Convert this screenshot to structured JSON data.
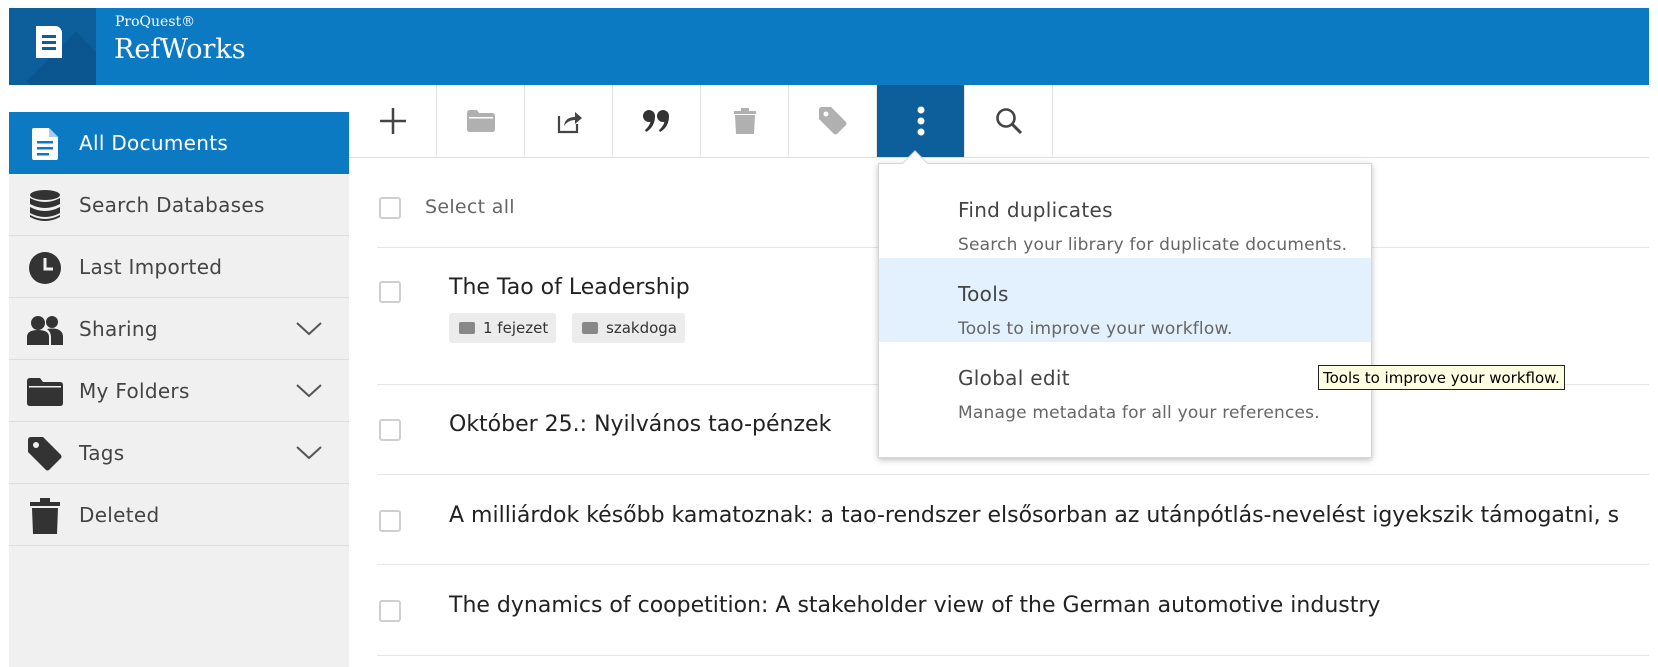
{
  "header": {
    "brand_small": "ProQuest®",
    "brand_large": "RefWorks",
    "color": "#0c79c3"
  },
  "sidebar": {
    "items": [
      {
        "label": "All Documents",
        "icon": "document-icon",
        "active": true
      },
      {
        "label": "Search Databases",
        "icon": "database-icon"
      },
      {
        "label": "Last Imported",
        "icon": "clock-icon"
      },
      {
        "label": "Sharing",
        "icon": "people-icon",
        "expandable": true
      },
      {
        "label": "My Folders",
        "icon": "folder-icon",
        "expandable": true
      },
      {
        "label": "Tags",
        "icon": "tag-icon",
        "expandable": true
      },
      {
        "label": "Deleted",
        "icon": "trash-icon"
      }
    ]
  },
  "toolbar": {
    "buttons": [
      "add-icon",
      "folder-icon",
      "share-icon",
      "quote-icon",
      "trash-icon",
      "tag-icon",
      "more-vertical-icon",
      "search-icon"
    ],
    "active": "more-vertical-icon"
  },
  "list": {
    "select_all_label": "Select all",
    "rows": [
      {
        "title": "The Tao of Leadership",
        "folders": [
          "1 fejezet",
          "szakdoga"
        ]
      },
      {
        "title": "Október 25.: Nyilvános tao-pénzek"
      },
      {
        "title": "A milliárdok később kamatoznak: a tao-rendszer elsősorban az utánpótlás-nevelést igyekszik támogatni, s"
      },
      {
        "title": "The dynamics of coopetition: A stakeholder view of the German automotive industry"
      }
    ]
  },
  "menu": {
    "items": [
      {
        "title": "Find duplicates",
        "description": "Search your library for duplicate documents."
      },
      {
        "title": "Tools",
        "description": "Tools to improve your workflow.",
        "hovered": true
      },
      {
        "title": "Global edit",
        "description": "Manage metadata for all your references."
      }
    ]
  },
  "tooltip": "Tools to improve your workflow."
}
